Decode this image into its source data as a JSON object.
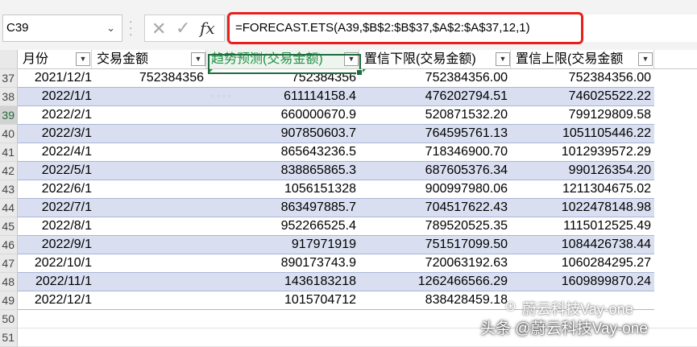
{
  "name_box": {
    "value": "C39"
  },
  "formula_bar": {
    "formula": "=FORECAST.ETS(A39,$B$2:$B$37,$A$2:$A$37,12,1)",
    "fx_label": "fx"
  },
  "columns": [
    {
      "key": "A",
      "header": "月份"
    },
    {
      "key": "B",
      "header": "交易金额"
    },
    {
      "key": "C",
      "header": "趋势预测(交易金额)"
    },
    {
      "key": "D",
      "header": "置信下限(交易金额)"
    },
    {
      "key": "E",
      "header": "置信上限(交易金额"
    }
  ],
  "rows": [
    {
      "num": "37",
      "a": "2021/12/1",
      "b": "752384356",
      "c": "752384356",
      "d": "752384356.00",
      "e": "752384356.00"
    },
    {
      "num": "38",
      "a": "2022/1/1",
      "b": "",
      "c": "611114158.4",
      "d": "476202794.51",
      "e": "746025522.22"
    },
    {
      "num": "39",
      "a": "2022/2/1",
      "b": "",
      "c": "660000670.9",
      "d": "520871532.20",
      "e": "799129809.58"
    },
    {
      "num": "40",
      "a": "2022/3/1",
      "b": "",
      "c": "907850603.7",
      "d": "764595761.13",
      "e": "1051105446.22"
    },
    {
      "num": "41",
      "a": "2022/4/1",
      "b": "",
      "c": "865643236.5",
      "d": "718346900.70",
      "e": "1012939572.29"
    },
    {
      "num": "42",
      "a": "2022/5/1",
      "b": "",
      "c": "838865865.3",
      "d": "687605376.34",
      "e": "990126354.20"
    },
    {
      "num": "43",
      "a": "2022/6/1",
      "b": "",
      "c": "1056151328",
      "d": "900997980.06",
      "e": "1211304675.02"
    },
    {
      "num": "44",
      "a": "2022/7/1",
      "b": "",
      "c": "863497885.7",
      "d": "704517622.43",
      "e": "1022478148.98"
    },
    {
      "num": "45",
      "a": "2022/8/1",
      "b": "",
      "c": "952266525.4",
      "d": "789520525.35",
      "e": "1115012525.49"
    },
    {
      "num": "46",
      "a": "2022/9/1",
      "b": "",
      "c": "917971919",
      "d": "751517099.50",
      "e": "1084426738.44"
    },
    {
      "num": "47",
      "a": "2022/10/1",
      "b": "",
      "c": "890173743.9",
      "d": "720063192.63",
      "e": "1060284295.27"
    },
    {
      "num": "48",
      "a": "2022/11/1",
      "b": "",
      "c": "1436183218",
      "d": "1262466566.29",
      "e": "1609899870.24"
    },
    {
      "num": "49",
      "a": "2022/12/1",
      "b": "",
      "c": "1015704712",
      "d": "838428459.18",
      "e": ""
    }
  ],
  "empty_rows": [
    "50",
    "51"
  ],
  "watermark": {
    "line1": "蔚云科技Vay-one",
    "line2": "头条 @蔚云科技Vay-one"
  }
}
